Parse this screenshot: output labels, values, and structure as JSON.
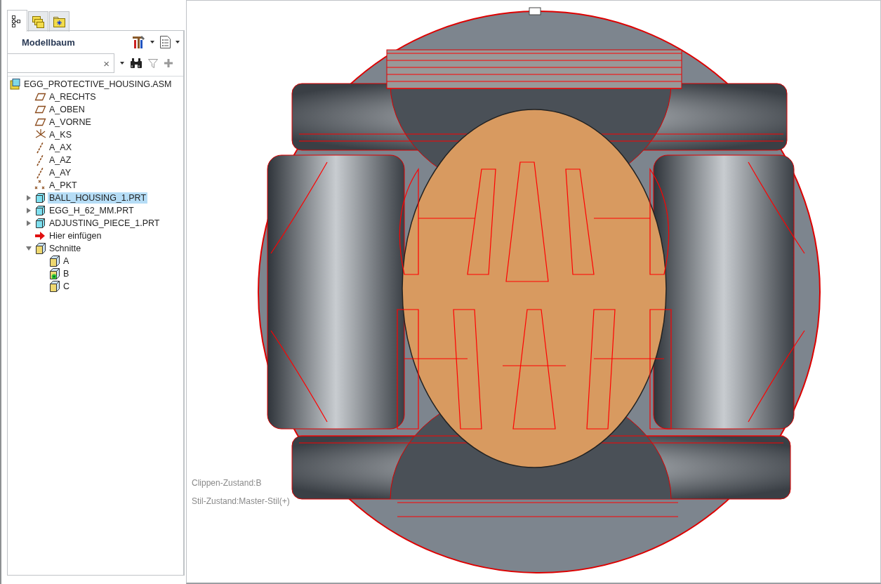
{
  "sidebar": {
    "tabs": [
      {
        "kind": "tree",
        "selected": true
      },
      {
        "kind": "layers",
        "selected": false
      },
      {
        "kind": "favorites",
        "selected": false
      }
    ],
    "title": "Modellbaum",
    "search": {
      "clear": "×"
    },
    "tree": {
      "label": "EGG_PROTECTIVE_HOUSING.ASM",
      "kind": "assembly",
      "selected": false,
      "children": [
        {
          "label": "A_RECHTS",
          "kind": "plane",
          "selected": false
        },
        {
          "label": "A_OBEN",
          "kind": "plane",
          "selected": false
        },
        {
          "label": "A_VORNE",
          "kind": "plane",
          "selected": false
        },
        {
          "label": "A_KS",
          "kind": "csys",
          "selected": false
        },
        {
          "label": "A_AX",
          "kind": "axis",
          "selected": false
        },
        {
          "label": "A_AZ",
          "kind": "axis",
          "selected": false
        },
        {
          "label": "A_AY",
          "kind": "axis",
          "selected": false
        },
        {
          "label": "A_PKT",
          "kind": "point",
          "selected": false
        },
        {
          "label": "BALL_HOUSING_1.PRT",
          "kind": "part",
          "selected": true,
          "expanded": false
        },
        {
          "label": "EGG_H_62_MM.PRT",
          "kind": "part",
          "selected": false,
          "expanded": false
        },
        {
          "label": "ADJUSTING_PIECE_1.PRT",
          "kind": "part",
          "selected": false,
          "expanded": false
        },
        {
          "label": "Hier einfügen",
          "kind": "insert",
          "selected": false
        },
        {
          "label": "Schnitte",
          "kind": "sections",
          "selected": false,
          "expanded": true,
          "children": [
            {
              "label": "A",
              "kind": "section",
              "selected": false,
              "active": false
            },
            {
              "label": "B",
              "kind": "section",
              "selected": false,
              "active": true
            },
            {
              "label": "C",
              "kind": "section",
              "selected": false,
              "active": false
            }
          ]
        }
      ]
    }
  },
  "viewport": {
    "status": [
      "Clippen-Zustand:B",
      "Stil-Zustand:Master-Stil(+)"
    ]
  }
}
